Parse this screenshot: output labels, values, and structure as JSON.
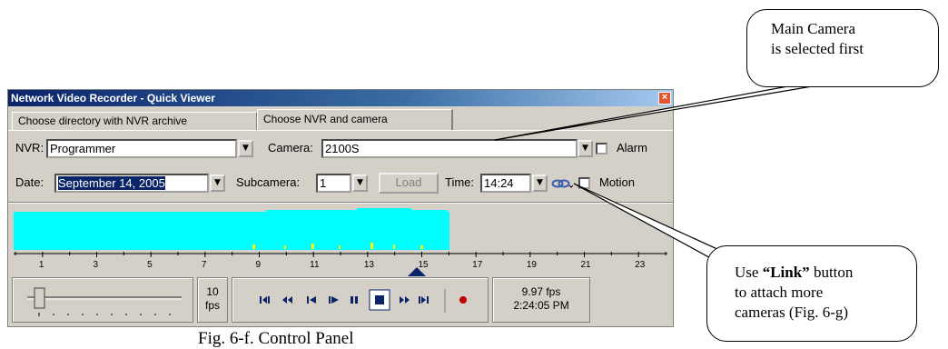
{
  "window": {
    "title": "Network Video Recorder - Quick Viewer",
    "close_glyph": "×"
  },
  "tabs": [
    {
      "label": "Choose directory with NVR archive"
    },
    {
      "label": "Choose NVR and camera"
    }
  ],
  "form": {
    "nvr_label": "NVR:",
    "nvr_value": "Programmer",
    "camera_label": "Camera:",
    "camera_value": "2100S",
    "alarm_label": "Alarm",
    "date_label": "Date:",
    "date_value": "September 14, 2005",
    "subcamera_label": "Subcamera:",
    "subcamera_value": "1",
    "load_label": "Load",
    "time_label": "Time:",
    "time_value": "14:24",
    "motion_label": "Motion",
    "dropdown_glyph": "▼"
  },
  "timeline": {
    "tick_labels": [
      "1",
      "3",
      "5",
      "7",
      "9",
      "11",
      "13",
      "15",
      "17",
      "19",
      "21",
      "23"
    ],
    "activity_color": "#00ffff",
    "marker_color": "#0a246a"
  },
  "playback": {
    "fps_value": "10",
    "fps_unit": "fps",
    "status_fps": "9.97 fps",
    "status_time": "2:24:05 PM",
    "icons": [
      "prev-mark-icon",
      "fast-rewind-icon",
      "step-back-icon",
      "play-reverse-icon",
      "pause-icon",
      "stop-icon",
      "fast-forward-icon",
      "next-mark-icon",
      "record-icon"
    ]
  },
  "callouts": {
    "main_line1": "Main Camera",
    "main_line2": "is selected first",
    "link_use": "Use ",
    "link_bold": "“Link”",
    "link_rest": " button",
    "link_line2": "to attach more",
    "link_line3": "cameras (Fig. 6-g)"
  },
  "caption": "Fig. 6-f. Control Panel"
}
